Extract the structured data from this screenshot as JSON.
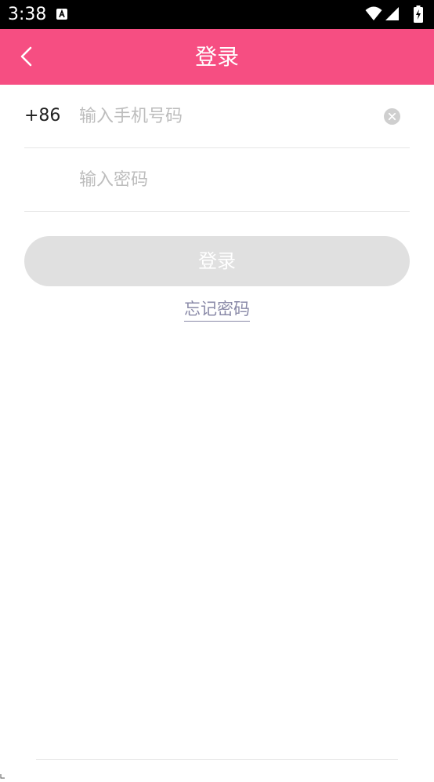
{
  "status_bar": {
    "time": "3:38",
    "icons": [
      "app-notification-icon",
      "wifi-icon",
      "signal-icon",
      "battery-charging-icon"
    ]
  },
  "header": {
    "title": "登录",
    "back_icon": "chevron-left-icon"
  },
  "form": {
    "country_code": "+86",
    "phone_placeholder": "输入手机号码",
    "phone_value": "",
    "clear_icon": "clear-circle-icon",
    "password_placeholder": "输入密码",
    "password_value": "",
    "login_label": "登录",
    "forgot_label": "忘记密码"
  },
  "colors": {
    "header_bg": "#f64e82",
    "login_button_disabled": "#e0e0e0",
    "link": "#8a8aa8",
    "placeholder": "#bdbdbd"
  }
}
